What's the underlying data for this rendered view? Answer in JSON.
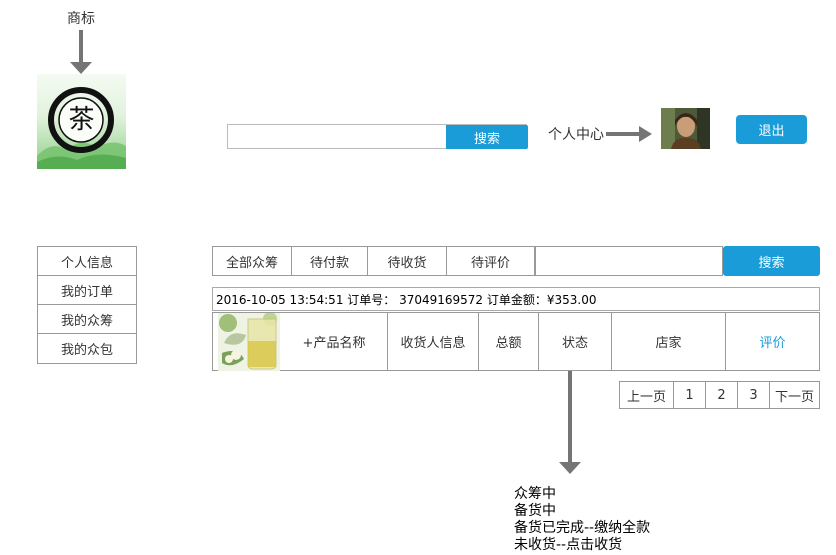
{
  "annotations": {
    "logo_label": "商标",
    "status_notes": [
      "众筹中",
      "备货中",
      "备货已完成--缴纳全款",
      "未收货--点击收货"
    ]
  },
  "header": {
    "logo_char": "茶",
    "search_placeholder": "",
    "search_button": "搜索",
    "personal_center": "个人中心",
    "logout": "退出"
  },
  "sidebar": {
    "items": [
      {
        "label": "个人信息"
      },
      {
        "label": "我的订单"
      },
      {
        "label": "我的众筹"
      },
      {
        "label": "我的众包"
      }
    ]
  },
  "orders": {
    "tabs": [
      {
        "label": "全部众筹"
      },
      {
        "label": "待付款"
      },
      {
        "label": "待收货"
      },
      {
        "label": "待评价"
      }
    ],
    "search_placeholder": "",
    "search_button": "搜索",
    "order_info": "2016-10-05 13:54:51 订单号： 37049169572 订单金额：¥353.00",
    "columns": {
      "product": "+产品名称",
      "recipient": "收货人信息",
      "total": "总额",
      "status": "状态",
      "shop": "店家",
      "review": "评价"
    },
    "review_color": "#1a9cd8"
  },
  "pagination": {
    "prev": "上一页",
    "pages": [
      "1",
      "2",
      "3"
    ],
    "next": "下一页"
  }
}
